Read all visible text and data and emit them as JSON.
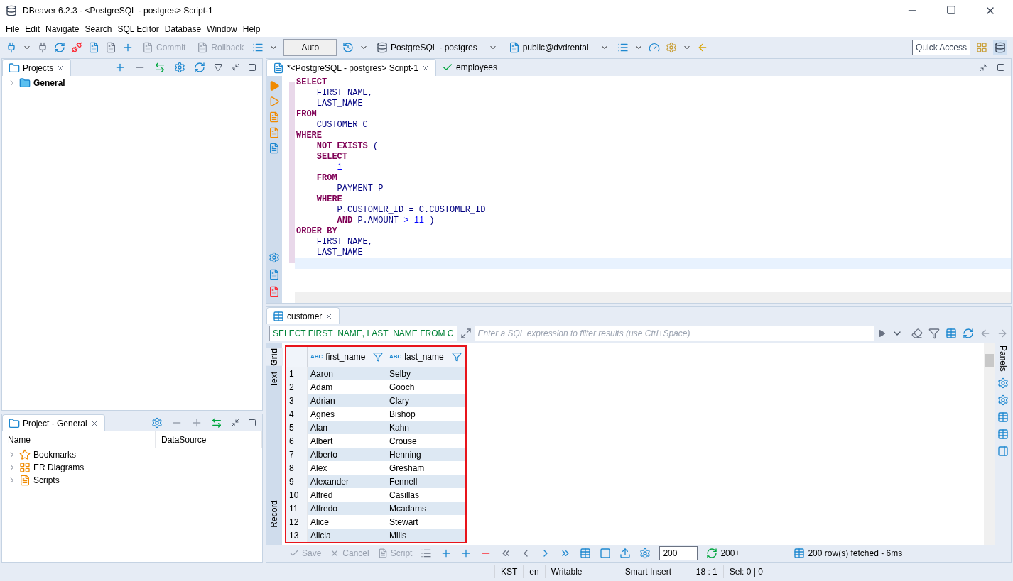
{
  "window": {
    "title": "DBeaver 6.2.3 - <PostgreSQL - postgres> Script-1"
  },
  "menu": [
    "File",
    "Edit",
    "Navigate",
    "Search",
    "SQL Editor",
    "Database",
    "Window",
    "Help"
  ],
  "toolbar": {
    "commit": {
      "label": "Commit",
      "disabled": true
    },
    "rollback": {
      "label": "Rollback",
      "disabled": true
    },
    "transaction_mode": "Auto",
    "connection": "PostgreSQL - postgres",
    "schema": "public@dvdrental",
    "quick_access": "Quick Access"
  },
  "projects_panel": {
    "tab": "Projects",
    "tree": [
      {
        "label": "General",
        "expanded": false
      }
    ]
  },
  "project_general_panel": {
    "tab": "Project - General",
    "columns": [
      "Name",
      "DataSource"
    ],
    "items": [
      {
        "label": "Bookmarks",
        "kind": "bookmarks",
        "expanded": false
      },
      {
        "label": "ER Diagrams",
        "kind": "diagrams",
        "expanded": false
      },
      {
        "label": "Scripts",
        "kind": "scripts",
        "expanded": false
      }
    ]
  },
  "editor_tabs": [
    {
      "label": "*<PostgreSQL - postgres> Script-1",
      "selected": true
    },
    {
      "label": "employees",
      "selected": false
    }
  ],
  "sql_lines": [
    [
      {
        "kind": "keyword",
        "text": "SELECT"
      }
    ],
    [
      {
        "kind": "text",
        "text": "    FIRST_NAME,"
      }
    ],
    [
      {
        "kind": "text",
        "text": "    LAST_NAME"
      }
    ],
    [
      {
        "kind": "keyword",
        "text": "FROM"
      }
    ],
    [
      {
        "kind": "text",
        "text": "    CUSTOMER C"
      }
    ],
    [
      {
        "kind": "keyword",
        "text": "WHERE"
      }
    ],
    [
      {
        "kind": "keyword",
        "text": "    NOT EXISTS"
      },
      {
        "kind": "text",
        "text": " ("
      }
    ],
    [
      {
        "kind": "keyword",
        "text": "    SELECT"
      }
    ],
    [
      {
        "kind": "number",
        "text": "        1"
      }
    ],
    [
      {
        "kind": "keyword",
        "text": "    FROM"
      }
    ],
    [
      {
        "kind": "text",
        "text": "        PAYMENT P"
      }
    ],
    [
      {
        "kind": "keyword",
        "text": "    WHERE"
      }
    ],
    [
      {
        "kind": "text",
        "text": "        P.CUSTOMER_ID = C.CUSTOMER_ID"
      }
    ],
    [
      {
        "kind": "keyword",
        "text": "        AND"
      },
      {
        "kind": "text",
        "text": " P.AMOUNT "
      },
      {
        "kind": "number",
        "text": "> 11"
      },
      {
        "kind": "text",
        "text": " )"
      }
    ],
    [
      {
        "kind": "keyword",
        "text": "ORDER BY"
      }
    ],
    [
      {
        "kind": "text",
        "text": "    FIRST_NAME,"
      }
    ],
    [
      {
        "kind": "text",
        "text": "    LAST_NAME"
      }
    ]
  ],
  "results": {
    "tab": "customer",
    "filter_query": "SELECT FIRST_NAME, LAST_NAME FROM C",
    "filter_placeholder": "Enter a SQL expression to filter results (use Ctrl+Space)",
    "highlighted": true,
    "side_tabs": [
      {
        "label": "Grid",
        "selected": true
      },
      {
        "label": "Text",
        "selected": false
      },
      {
        "label": "Record",
        "selected": false
      }
    ],
    "panels_label": "Panels",
    "columns": [
      {
        "type": "ABC",
        "name": "first_name"
      },
      {
        "type": "ABC",
        "name": "last_name"
      }
    ],
    "rows": [
      {
        "number": "1",
        "cells": [
          "Aaron",
          "Selby"
        ]
      },
      {
        "number": "2",
        "cells": [
          "Adam",
          "Gooch"
        ]
      },
      {
        "number": "3",
        "cells": [
          "Adrian",
          "Clary"
        ]
      },
      {
        "number": "4",
        "cells": [
          "Agnes",
          "Bishop"
        ]
      },
      {
        "number": "5",
        "cells": [
          "Alan",
          "Kahn"
        ]
      },
      {
        "number": "6",
        "cells": [
          "Albert",
          "Crouse"
        ]
      },
      {
        "number": "7",
        "cells": [
          "Alberto",
          "Henning"
        ]
      },
      {
        "number": "8",
        "cells": [
          "Alex",
          "Gresham"
        ]
      },
      {
        "number": "9",
        "cells": [
          "Alexander",
          "Fennell"
        ]
      },
      {
        "number": "10",
        "cells": [
          "Alfred",
          "Casillas"
        ]
      },
      {
        "number": "11",
        "cells": [
          "Alfredo",
          "Mcadams"
        ]
      },
      {
        "number": "12",
        "cells": [
          "Alice",
          "Stewart"
        ]
      },
      {
        "number": "13",
        "cells": [
          "Alicia",
          "Mills"
        ]
      }
    ],
    "footer": {
      "save": "Save",
      "cancel": "Cancel",
      "script": "Script",
      "fetch_size": "200",
      "fetch_more": "200+",
      "status": "200 row(s) fetched - 6ms"
    }
  },
  "status_bar": [
    "KST",
    "en",
    "Writable",
    "Smart Insert",
    "18 : 1",
    "Sel: 0 | 0"
  ]
}
